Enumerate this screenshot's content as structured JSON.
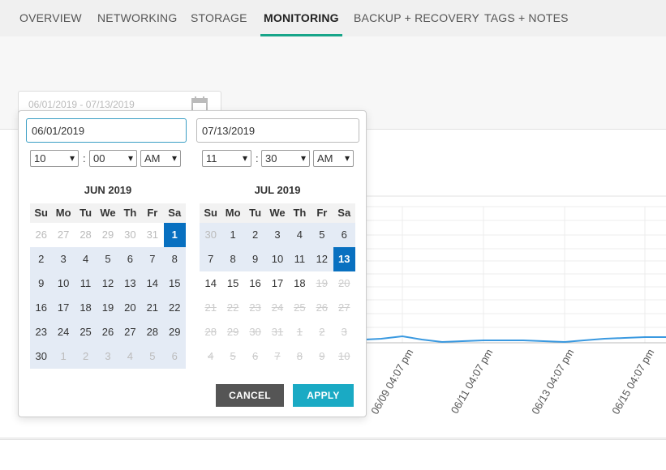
{
  "tabs": [
    {
      "label": "OVERVIEW",
      "active": false
    },
    {
      "label": "NETWORKING",
      "active": false
    },
    {
      "label": "STORAGE",
      "active": false
    },
    {
      "label": "MONITORING",
      "active": true
    },
    {
      "label": "BACKUP + RECOVERY",
      "active": false
    },
    {
      "label": "TAGS + NOTES",
      "active": false
    }
  ],
  "range_field": {
    "value": "06/01/2019 - 07/13/2019"
  },
  "chart": {
    "x_labels": [
      "06/09 04:07 pm",
      "06/11 04:07 pm",
      "06/13 04:07 pm",
      "06/15 04:07 pm"
    ],
    "line_color": "#3a99e0"
  },
  "picker": {
    "start_date": "06/01/2019",
    "end_date": "07/13/2019",
    "start_time": {
      "hour": "10",
      "minute": "00",
      "ampm": "AM"
    },
    "end_time": {
      "hour": "11",
      "minute": "30",
      "ampm": "AM"
    },
    "weekdays": [
      "Su",
      "Mo",
      "Tu",
      "We",
      "Th",
      "Fr",
      "Sa"
    ],
    "calendars": [
      {
        "title": "JUN 2019",
        "weeks": [
          [
            {
              "d": "26",
              "s": "off"
            },
            {
              "d": "27",
              "s": "off"
            },
            {
              "d": "28",
              "s": "off"
            },
            {
              "d": "29",
              "s": "off"
            },
            {
              "d": "30",
              "s": "off"
            },
            {
              "d": "31",
              "s": "off"
            },
            {
              "d": "1",
              "s": "selected"
            }
          ],
          [
            {
              "d": "2",
              "s": "in"
            },
            {
              "d": "3",
              "s": "in"
            },
            {
              "d": "4",
              "s": "in"
            },
            {
              "d": "5",
              "s": "in"
            },
            {
              "d": "6",
              "s": "in"
            },
            {
              "d": "7",
              "s": "in"
            },
            {
              "d": "8",
              "s": "in"
            }
          ],
          [
            {
              "d": "9",
              "s": "in"
            },
            {
              "d": "10",
              "s": "in"
            },
            {
              "d": "11",
              "s": "in"
            },
            {
              "d": "12",
              "s": "in"
            },
            {
              "d": "13",
              "s": "in"
            },
            {
              "d": "14",
              "s": "in"
            },
            {
              "d": "15",
              "s": "in"
            }
          ],
          [
            {
              "d": "16",
              "s": "in"
            },
            {
              "d": "17",
              "s": "in"
            },
            {
              "d": "18",
              "s": "in"
            },
            {
              "d": "19",
              "s": "in"
            },
            {
              "d": "20",
              "s": "in"
            },
            {
              "d": "21",
              "s": "in"
            },
            {
              "d": "22",
              "s": "in"
            }
          ],
          [
            {
              "d": "23",
              "s": "in"
            },
            {
              "d": "24",
              "s": "in"
            },
            {
              "d": "25",
              "s": "in"
            },
            {
              "d": "26",
              "s": "in"
            },
            {
              "d": "27",
              "s": "in"
            },
            {
              "d": "28",
              "s": "in"
            },
            {
              "d": "29",
              "s": "in"
            }
          ],
          [
            {
              "d": "30",
              "s": "in"
            },
            {
              "d": "1",
              "s": "in-off"
            },
            {
              "d": "2",
              "s": "in-off"
            },
            {
              "d": "3",
              "s": "in-off"
            },
            {
              "d": "4",
              "s": "in-off"
            },
            {
              "d": "5",
              "s": "in-off"
            },
            {
              "d": "6",
              "s": "in-off"
            }
          ]
        ]
      },
      {
        "title": "JUL 2019",
        "weeks": [
          [
            {
              "d": "30",
              "s": "in-off"
            },
            {
              "d": "1",
              "s": "in"
            },
            {
              "d": "2",
              "s": "in"
            },
            {
              "d": "3",
              "s": "in"
            },
            {
              "d": "4",
              "s": "in"
            },
            {
              "d": "5",
              "s": "in"
            },
            {
              "d": "6",
              "s": "in"
            }
          ],
          [
            {
              "d": "7",
              "s": "in"
            },
            {
              "d": "8",
              "s": "in"
            },
            {
              "d": "9",
              "s": "in"
            },
            {
              "d": "10",
              "s": "in"
            },
            {
              "d": "11",
              "s": "in"
            },
            {
              "d": "12",
              "s": "in"
            },
            {
              "d": "13",
              "s": "selected"
            }
          ],
          [
            {
              "d": "14",
              "s": "normal"
            },
            {
              "d": "15",
              "s": "normal"
            },
            {
              "d": "16",
              "s": "normal"
            },
            {
              "d": "17",
              "s": "normal"
            },
            {
              "d": "18",
              "s": "normal"
            },
            {
              "d": "19",
              "s": "disabled"
            },
            {
              "d": "20",
              "s": "disabled"
            }
          ],
          [
            {
              "d": "21",
              "s": "disabled"
            },
            {
              "d": "22",
              "s": "disabled"
            },
            {
              "d": "23",
              "s": "disabled"
            },
            {
              "d": "24",
              "s": "disabled"
            },
            {
              "d": "25",
              "s": "disabled"
            },
            {
              "d": "26",
              "s": "disabled"
            },
            {
              "d": "27",
              "s": "disabled"
            }
          ],
          [
            {
              "d": "28",
              "s": "disabled"
            },
            {
              "d": "29",
              "s": "disabled"
            },
            {
              "d": "30",
              "s": "disabled"
            },
            {
              "d": "31",
              "s": "disabled"
            },
            {
              "d": "1",
              "s": "disabled"
            },
            {
              "d": "2",
              "s": "disabled"
            },
            {
              "d": "3",
              "s": "disabled"
            }
          ],
          [
            {
              "d": "4",
              "s": "disabled"
            },
            {
              "d": "5",
              "s": "disabled"
            },
            {
              "d": "6",
              "s": "disabled"
            },
            {
              "d": "7",
              "s": "disabled"
            },
            {
              "d": "8",
              "s": "disabled"
            },
            {
              "d": "9",
              "s": "disabled"
            },
            {
              "d": "10",
              "s": "disabled"
            }
          ]
        ]
      }
    ],
    "cancel_label": "CANCEL",
    "apply_label": "APPLY"
  }
}
